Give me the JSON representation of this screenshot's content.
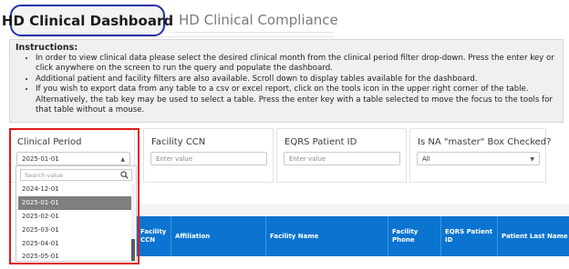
{
  "tabs": {
    "active": "HD Clinical Dashboard",
    "inactive": "HD Clinical Compliance"
  },
  "instructions": {
    "title": "Instructions:",
    "items": [
      "In order to view clinical data please select the desired clinical month from the clinical period filter drop-down. Press the enter key or click anywhere on the screen to run the query and populate the dashboard.",
      "Additional patient and facility filters are also available. Scroll down to display tables available for the dashboard.",
      "If you wish to export data from any table to a csv or excel report, click on the tools icon in the upper right corner of the table. Alternatively, the tab key may be used to select a table. Press the enter key with a table selected to move the focus to the tools for that table without a mouse."
    ]
  },
  "filters": {
    "clinical_period": {
      "label": "Clinical Period",
      "value": "2025-01-01",
      "search_placeholder": "Search value",
      "options": [
        "2024-12-01",
        "2025-01-01",
        "2025-02-01",
        "2025-03-01",
        "2025-04-01",
        "2025-05-01"
      ],
      "selected": "2025-01-01"
    },
    "facility_ccn": {
      "label": "Facility CCN",
      "placeholder": "Enter value"
    },
    "eqrs_patient_id": {
      "label": "EQRS Patient ID",
      "placeholder": "Enter value"
    },
    "na_master": {
      "label": "Is NA \"master\" Box Checked?",
      "value": "All"
    }
  },
  "table": {
    "headers": [
      "Facility CCN",
      "Affiliation",
      "Facility Name",
      "Facility Phone",
      "EQRS Patient ID",
      "Patient Last Name"
    ]
  },
  "colors": {
    "tab_outline": "#2233a8",
    "highlight_red": "#e01919",
    "table_header_blue": "#0b74d0"
  },
  "icons": {
    "search": "search-icon",
    "dropdown": "chevron-up-icon / chevron-down-icon"
  }
}
